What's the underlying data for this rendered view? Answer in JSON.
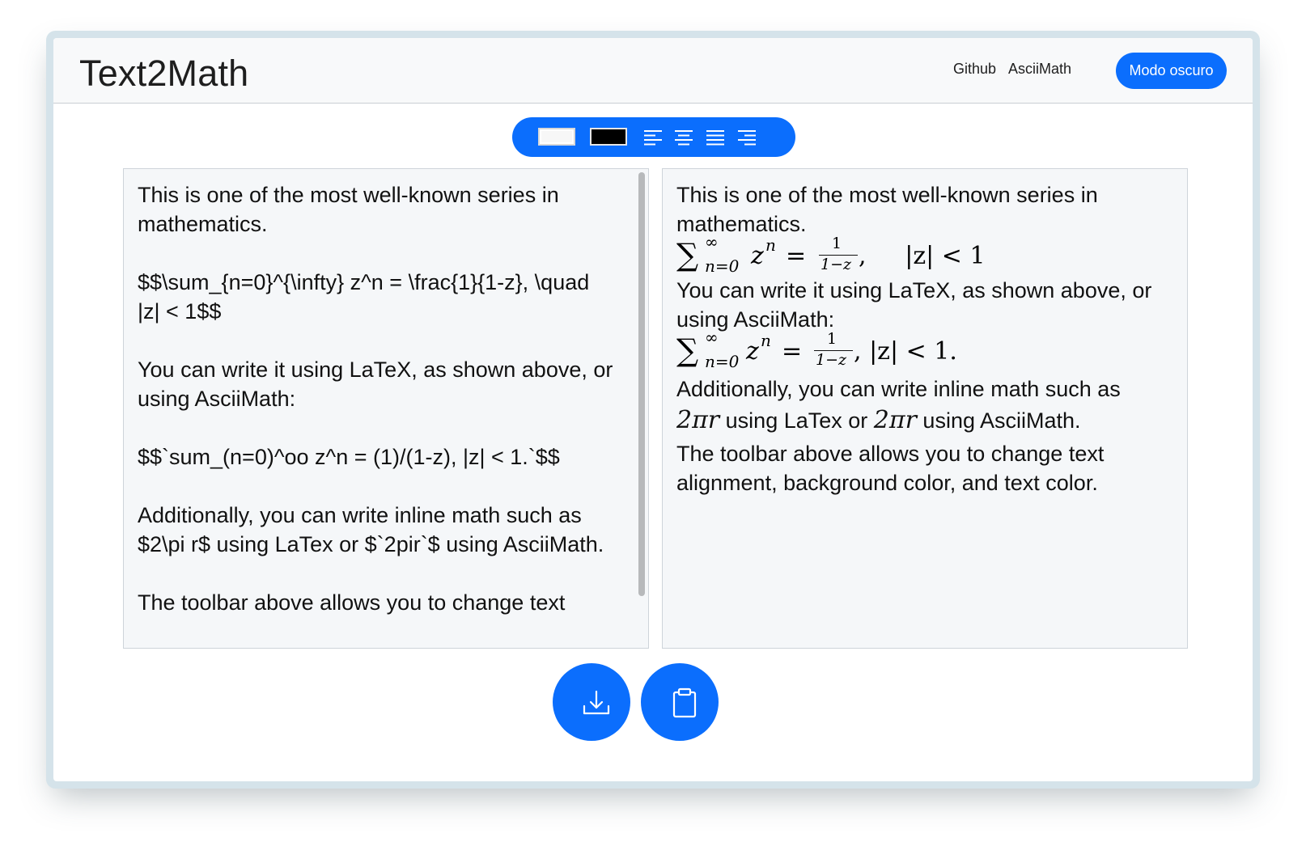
{
  "navbar": {
    "brand": "Text2Math",
    "links": [
      "Github",
      "AsciiMath"
    ],
    "dark_mode_label": "Modo oscuro"
  },
  "toolbar": {
    "swatches": [
      "white-background",
      "black-background"
    ],
    "align_icons": [
      "align-left-icon",
      "align-center-icon",
      "align-justify-icon",
      "align-right-icon"
    ]
  },
  "editor": {
    "text": "This is one of the most well-known series in mathematics.\n\n$$\\sum_{n=0}^{\\infty} z^n = \\frac{1}{1-z}, \\quad |z| < 1$$\n\nYou can write it using LaTeX, as shown above, or using AsciiMath:\n\n$$`sum_(n=0)^oo z^n = (1)/(1-z), |z| < 1.`$$\n\nAdditionally, you can write inline math such as $2\\pi r$ using LaTex or $`2pir`$ using AsciiMath.\n\nThe toolbar above allows you to change text"
  },
  "preview": {
    "p1": "This is one of the most well-known series in mathematics.",
    "eq1_lhs": "∑",
    "eq1_sup": "∞",
    "eq1_sub": "n=0",
    "eq1_z": "z",
    "eq1_n": "n",
    "eq1_eq": "=",
    "eq1_num": "1",
    "eq1_den": "1−z",
    "eq1_rest": ",     |z| < 1",
    "p2": "You can write it using LaTeX, as shown above, or using AsciiMath:",
    "eq2_rest": ", |z| < 1.",
    "p3a": "Additionally, you can write inline math such as",
    "inline1": "2πr",
    "p3b": " using LaTex or ",
    "inline2": "2πr",
    "p3c": " using AsciiMath.",
    "p4": "The toolbar above allows you to change text alignment, background color, and text color."
  },
  "actions": {
    "download": "download-icon",
    "copy": "clipboard-icon"
  },
  "colors": {
    "accent": "#0b6efd",
    "panel_bg": "#f5f7f9"
  }
}
